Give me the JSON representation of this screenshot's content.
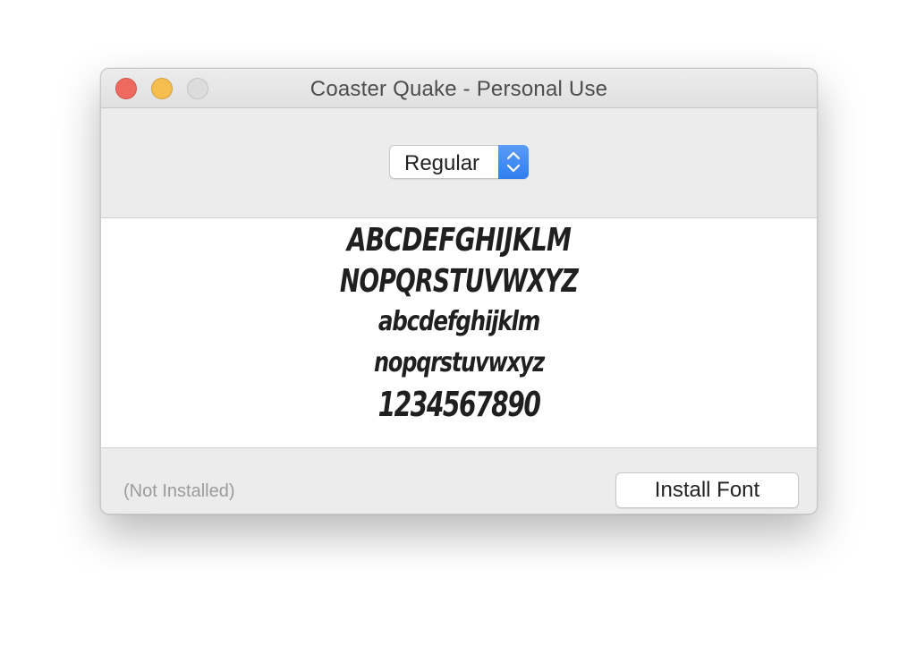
{
  "window": {
    "title": "Coaster Quake - Personal Use"
  },
  "style_select": {
    "selected": "Regular",
    "accent_color": "#3a86f5"
  },
  "preview": {
    "lines": [
      "ABCDEFGHIJKLM",
      "NOPQRSTUVWXYZ",
      "abcdefghijklm",
      "nopqrstuvwxyz",
      "1234567890"
    ]
  },
  "footer": {
    "status": "(Not Installed)",
    "install_label": "Install Font"
  },
  "icons": {
    "close": "close-icon",
    "minimize": "minimize-icon",
    "zoom": "zoom-icon",
    "stepper": "up-down-chevron-icon"
  }
}
